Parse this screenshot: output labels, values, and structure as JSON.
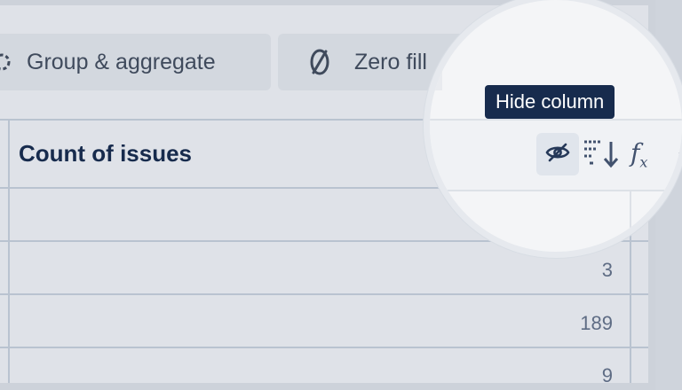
{
  "toolbar": {
    "group_aggregate_label": "Group & aggregate",
    "zero_fill_label": "Zero fill"
  },
  "table": {
    "column_header": "Count of issues",
    "rows": [
      "",
      "3",
      "189",
      "9"
    ]
  },
  "column_actions": {
    "hide_tooltip": "Hide column",
    "hide_icon": "eye-slash-icon",
    "sort_icon": "sort-descending-icon",
    "formula_icon": "fx-icon",
    "more_glyph": "⋯"
  },
  "colors": {
    "header_text": "#172b4d",
    "tooltip_bg": "#172b4d",
    "icon": "#42526e"
  }
}
